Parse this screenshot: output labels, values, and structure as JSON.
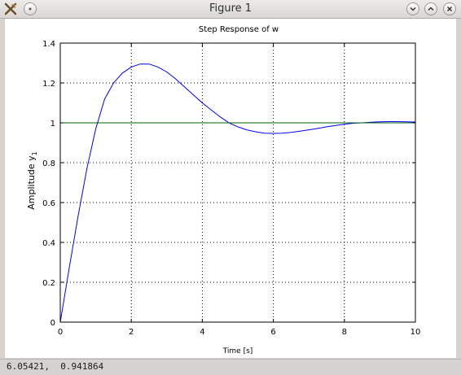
{
  "window": {
    "title": "Figure 1"
  },
  "status": {
    "text": "6.05421,  0.941864"
  },
  "chart_data": {
    "type": "line",
    "title": "Step Response of w",
    "xlabel": "Time [s]",
    "ylabel_main": "Amplitude y",
    "ylabel_sub": "1",
    "xlim": [
      0,
      10
    ],
    "ylim": [
      0,
      1.4
    ],
    "xticks": [
      0,
      2,
      4,
      6,
      8,
      10
    ],
    "yticks": [
      0,
      0.2,
      0.4,
      0.6,
      0.8,
      1,
      1.2,
      1.4
    ],
    "grid": true,
    "series": [
      {
        "color": "#0000ff",
        "x": [
          0,
          0.25,
          0.5,
          0.75,
          1,
          1.25,
          1.5,
          1.75,
          2,
          2.25,
          2.5,
          2.75,
          3,
          3.25,
          3.5,
          3.75,
          4,
          4.25,
          4.5,
          4.75,
          5,
          5.25,
          5.5,
          5.75,
          6,
          6.25,
          6.5,
          6.75,
          7,
          7.25,
          7.5,
          7.75,
          8,
          8.25,
          8.5,
          8.75,
          9,
          9.25,
          9.5,
          9.75,
          10
        ],
        "y": [
          0,
          0.27,
          0.53,
          0.77,
          0.97,
          1.12,
          1.2,
          1.25,
          1.28,
          1.295,
          1.295,
          1.28,
          1.255,
          1.22,
          1.18,
          1.14,
          1.1,
          1.065,
          1.03,
          1.0,
          0.98,
          0.965,
          0.955,
          0.948,
          0.947,
          0.948,
          0.952,
          0.958,
          0.965,
          0.972,
          0.98,
          0.987,
          0.993,
          0.998,
          1.0,
          1.003,
          1.005,
          1.006,
          1.006,
          1.005,
          1.004
        ]
      },
      {
        "color": "#006400",
        "x": [
          0,
          10
        ],
        "y": [
          1,
          1
        ]
      }
    ]
  }
}
